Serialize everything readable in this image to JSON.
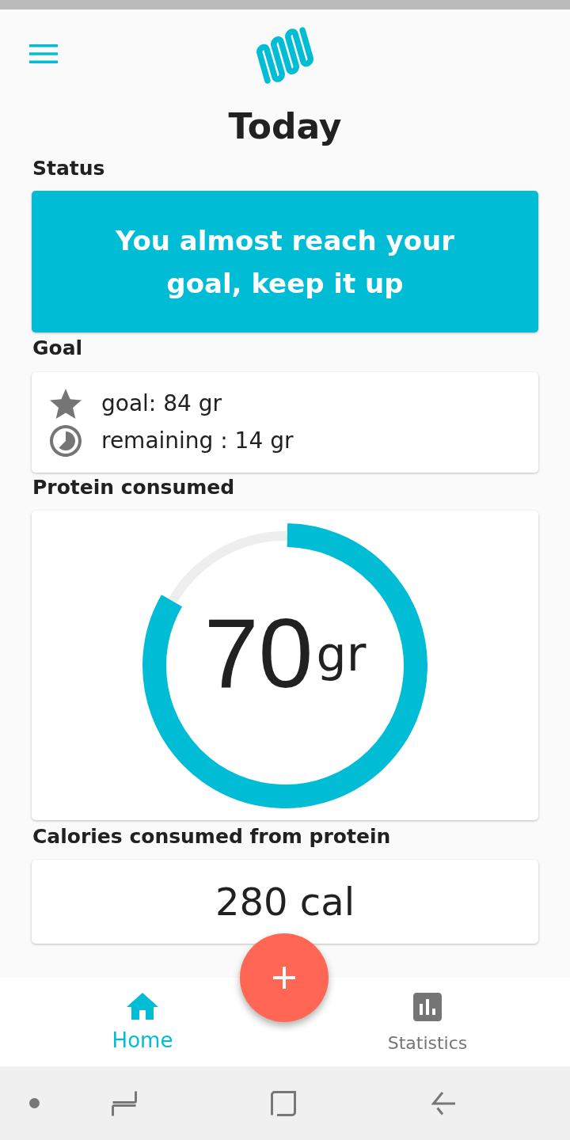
{
  "header": {
    "title": "Today"
  },
  "status": {
    "label": "Status",
    "message": "You almost reach your goal, keep it up"
  },
  "goal": {
    "label": "Goal",
    "items": [
      {
        "kind": "goal",
        "text": "goal: 84 gr"
      },
      {
        "kind": "remaining",
        "text": "remaining : 14 gr"
      }
    ]
  },
  "protein": {
    "label": "Protein consumed",
    "value": "70",
    "unit": "gr",
    "level": 0.83
  },
  "calories": {
    "label": "Calories consumed from protein",
    "value": "280 cal"
  },
  "bottom_nav": [
    {
      "kind": "home",
      "label": "Home",
      "selected": true
    },
    {
      "kind": "statistics",
      "label": "Statistics",
      "selected": false
    }
  ]
}
